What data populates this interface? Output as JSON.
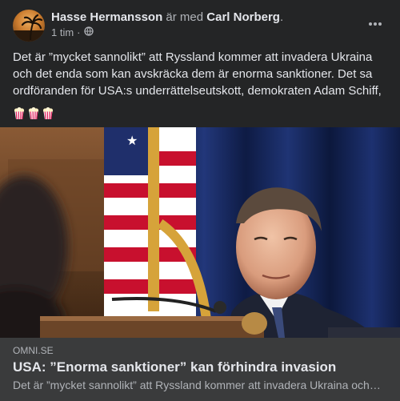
{
  "author": {
    "name": "Hasse Hermansson",
    "with_text": "är med",
    "tagged_name": "Carl Norberg",
    "period": "."
  },
  "meta": {
    "timestamp": "1 tim",
    "separator": "·",
    "audience_icon": "globe-icon"
  },
  "menu": {
    "icon": "more-horizontal-icon"
  },
  "post": {
    "text": "Det är ”mycket sannolikt” att Ryssland kommer att invadera Ukraina och det enda som kan avskräcka dem är enorma sanktioner. Det sa ordföranden för USA:s underrättelseutskott, demokraten Adam Schiff,",
    "emojis": [
      "popcorn-icon",
      "popcorn-icon",
      "popcorn-icon"
    ]
  },
  "link": {
    "domain": "OMNI.SE",
    "title": "USA: ”Enorma sanktioner” kan förhindra invasion",
    "description": "Det är ”mycket sannolikt” att Ryssland kommer att invadera Ukraina och det enda som kan avskräcka dem är enorma sanktioner."
  },
  "colors": {
    "background": "#242526",
    "link_box": "#3a3b3c",
    "text_primary": "#e4e6eb",
    "text_secondary": "#b0b3b8"
  }
}
